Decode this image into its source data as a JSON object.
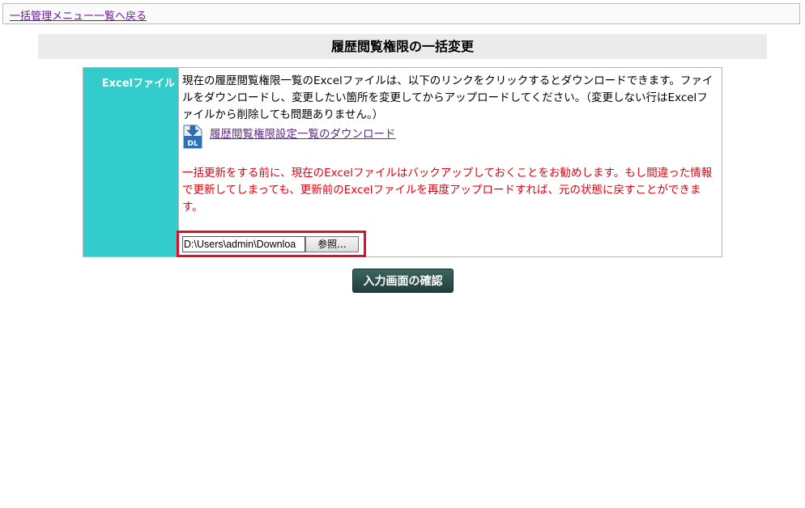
{
  "topbar": {
    "back_link": "一括管理メニュー一覧へ戻る"
  },
  "page": {
    "title": "履歴閲覧権限の一括変更"
  },
  "form": {
    "label": "Excelファイル",
    "description": "現在の履歴閲覧権限一覧のExcelファイルは、以下のリンクをクリックするとダウンロードできます。ファイルをダウンロードし、変更したい箇所を変更してからアップロードしてください。（変更しない行はExcelファイルから削除しても問題ありません。）",
    "download_icon_text": "DL",
    "download_link": "履歴閲覧権限設定一覧のダウンロード",
    "warning": "一括更新をする前に、現在のExcelファイルはバックアップしておくことをお勧めします。もし間違った情報で更新してしまっても、更新前のExcelファイルを再度アップロードすれば、元の状態に戻すことができます。",
    "file_path_value": "D:\\Users\\admin\\Downloa",
    "browse_label": "参照..."
  },
  "actions": {
    "confirm_label": "入力画面の確認"
  },
  "colors": {
    "label_bg": "#33cccc",
    "warning_text": "#e0000f",
    "highlight_border": "#e0102a",
    "confirm_bg": "#2f524e",
    "link": "#5e2b8a"
  }
}
